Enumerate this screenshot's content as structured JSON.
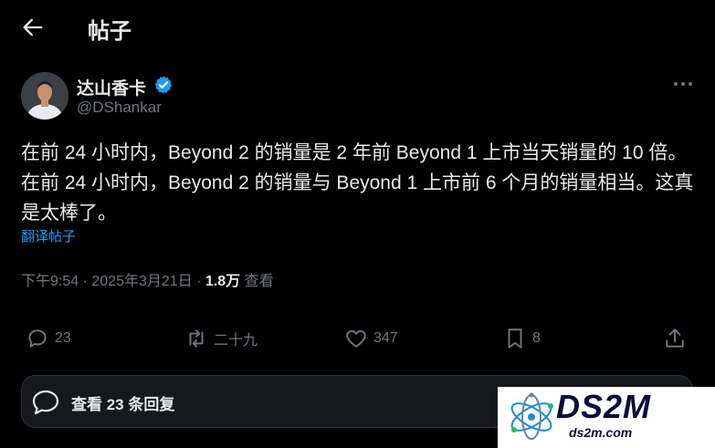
{
  "header": {
    "title": "帖子",
    "back_icon": "arrow-left-icon"
  },
  "author": {
    "name": "达山香卡",
    "handle": "@DShankar",
    "verified_icon": "verified-badge-icon",
    "verified_color": "#1d9bf0",
    "more_icon": "more-horizontal-icon"
  },
  "post": {
    "text": "在前 24 小时内，Beyond 2 的销量是 2 年前 Beyond 1 上市当天销量的 10 倍。在前 24 小时内，Beyond 2 的销量与 Beyond 1 上市前 6 个月的销量相当。这真是太棒了。",
    "translate_label": "翻译帖子"
  },
  "meta": {
    "time": "下午9:54",
    "sep1": " · ",
    "date": "2025年3月21日",
    "sep2": " · ",
    "views_count": "1.8万",
    "views_label": " 查看"
  },
  "actions": {
    "reply": {
      "icon": "reply-icon",
      "count": "23"
    },
    "repost": {
      "icon": "repost-icon",
      "count": "二十九"
    },
    "like": {
      "icon": "heart-icon",
      "count": "347"
    },
    "bookmark": {
      "icon": "bookmark-icon",
      "count": "8"
    },
    "share": {
      "icon": "share-icon"
    }
  },
  "replies": {
    "label": "查看 23 条回复",
    "icon": "chat-bubble-icon"
  },
  "watermark": {
    "big": "DS2M",
    "small": "ds2m.com"
  },
  "colors": {
    "background": "#000000",
    "text": "#e7e9ea",
    "muted": "#71767b",
    "accent": "#1d9bf0"
  }
}
